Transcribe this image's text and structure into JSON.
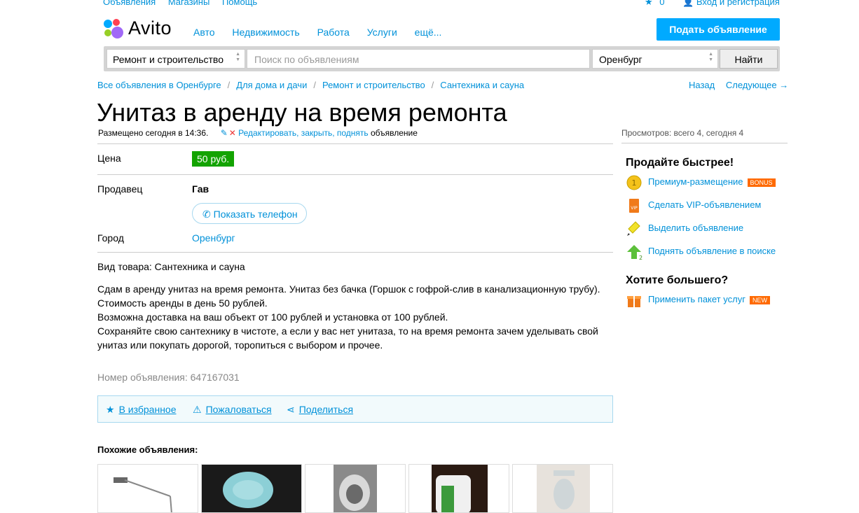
{
  "top": {
    "links": [
      "Объявления",
      "Магазины",
      "Помощь"
    ],
    "fav_count": "0",
    "login": "Вход и регистрация"
  },
  "logo": {
    "text": "Avito"
  },
  "nav": {
    "items": [
      "Авто",
      "Недвижимость",
      "Работа",
      "Услуги",
      "ещё..."
    ]
  },
  "post_button": "Подать объявление",
  "search": {
    "category": "Ремонт и строительство",
    "placeholder": "Поиск по объявлениям",
    "city": "Оренбург",
    "button": "Найти"
  },
  "breadcrumbs": [
    "Все объявления в Оренбурге",
    "Для дома и дачи",
    "Ремонт и строительство",
    "Сантехника и сауна"
  ],
  "pager": {
    "back": "Назад",
    "next": "Следующее →"
  },
  "ad": {
    "title": "Унитаз в аренду на время ремонта",
    "posted": "Размещено сегодня в 14:36.",
    "edit_links": "Редактировать, закрыть, поднять",
    "edit_suffix": "объявление",
    "views": "Просмотров: всего 4, сегодня 4",
    "price_label": "Цена",
    "price": "50 руб.",
    "seller_label": "Продавец",
    "seller": "Гав",
    "phone_button": "Показать телефон",
    "city_label": "Город",
    "city": "Оренбург",
    "kind": "Вид товара: Сантехника и сауна",
    "description": [
      "Сдам в аренду унитаз на время ремонта. Унитаз без бачка (Горшок с гофрой-слив в канализационную трубу).",
      "Стоимость аренды в день 50 рублей.",
      "Возможна доставка на ваш объект от 100 рублей и установка от 100 рублей.",
      "Сохраняйте свою сантехнику в чистоте, а если у вас нет унитаза, то на время ремонта зачем уделывать свой унитаз или покупать дорогой, торопиться с выбором и прочее."
    ],
    "ad_number": "Номер объявления: 647167031"
  },
  "actions": {
    "favorite": "В избранное",
    "report": "Пожаловаться",
    "share": "Поделиться"
  },
  "similar": {
    "title": "Похожие объявления:"
  },
  "sidebar": {
    "sell_title": "Продайте быстрее!",
    "services": [
      {
        "label": "Премиум-размещение",
        "tag": "BONUS"
      },
      {
        "label": "Сделать VIP-объявлением"
      },
      {
        "label": "Выделить объявление"
      },
      {
        "label": "Поднять объявление в поиске"
      }
    ],
    "more_title": "Хотите большего?",
    "package": {
      "label": "Применить пакет услуг",
      "tag": "NEW"
    }
  },
  "colors": {
    "accent": "#00aaff",
    "link": "#0091d9",
    "price_bg": "#13a300",
    "bonus": "#ff6a00",
    "new": "#ff6a00"
  }
}
